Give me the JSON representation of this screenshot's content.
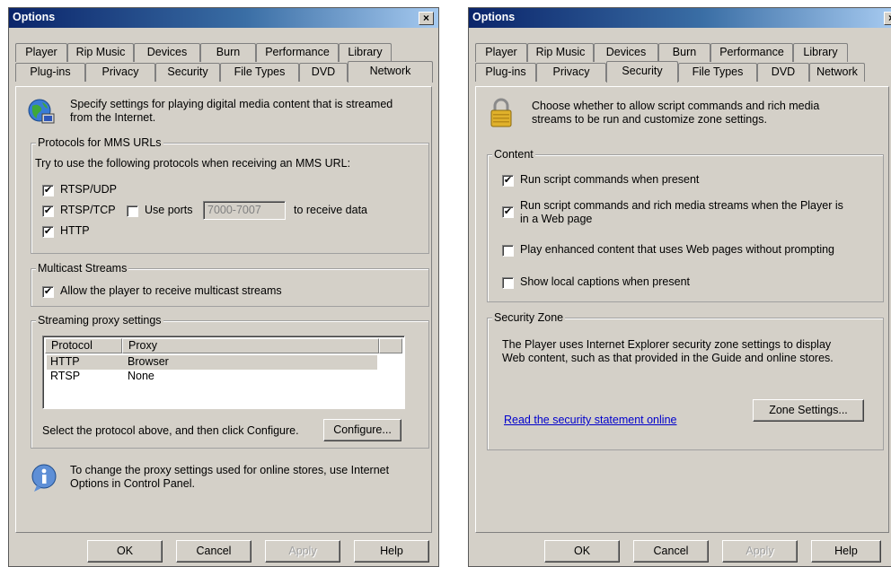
{
  "windowA": {
    "title": "Options",
    "close_glyph": "×",
    "tabs_row1": [
      "Player",
      "Rip Music",
      "Devices",
      "Burn",
      "Performance",
      "Library"
    ],
    "tabs_row2": [
      "Plug-ins",
      "Privacy",
      "Security",
      "File Types",
      "DVD",
      "Network"
    ],
    "active_tab": "Network",
    "intro_line1": "Specify settings for playing digital media content that is streamed",
    "intro_line2": "from the Internet.",
    "mms": {
      "legend": "Protocols for MMS URLs",
      "instruction": "Try to use the following protocols when receiving an MMS URL:",
      "rtsp_udp": "RTSP/UDP",
      "rtsp_tcp": "RTSP/TCP",
      "use_ports": "Use ports",
      "ports_value": "7000-7007",
      "receive_data": "to receive data",
      "http": "HTTP",
      "checked_mark": "✔"
    },
    "multicast": {
      "legend": "Multicast Streams",
      "allow": "Allow the player to receive multicast streams"
    },
    "proxy": {
      "legend": "Streaming proxy settings",
      "col_protocol": "Protocol",
      "col_proxy": "Proxy",
      "rows": [
        {
          "protocol": "HTTP",
          "proxy": "Browser"
        },
        {
          "protocol": "RTSP",
          "proxy": "None"
        }
      ],
      "hint": "Select the protocol above, and then click Configure.",
      "configure_label": "Configure..."
    },
    "store_note_line1": "To change the proxy settings used for online stores, use Internet",
    "store_note_line2": "Options in Control Panel.",
    "buttons": {
      "ok": "OK",
      "cancel": "Cancel",
      "apply": "Apply",
      "help": "Help"
    }
  },
  "windowB": {
    "title": "Options",
    "close_glyph": "×",
    "tabs_row1": [
      "Player",
      "Rip Music",
      "Devices",
      "Burn",
      "Performance",
      "Library"
    ],
    "tabs_row2": [
      "Plug-ins",
      "Privacy",
      "Security",
      "File Types",
      "DVD",
      "Network"
    ],
    "active_tab": "Security",
    "intro_line1": "Choose whether to allow script commands and rich media",
    "intro_line2": "streams to be run and customize zone settings.",
    "content": {
      "legend": "Content",
      "run_script": "Run script commands when present",
      "run_rich_line1": "Run script commands and rich media streams when the Player is",
      "run_rich_line2": "in a Web page",
      "enhanced": "Play enhanced content that uses Web pages without prompting",
      "captions": "Show local captions when present",
      "checked_mark": "✔"
    },
    "zone": {
      "legend": "Security Zone",
      "text_line1": "The Player uses Internet Explorer security zone settings to display",
      "text_line2": "Web content, such as that provided in the Guide and online stores.",
      "link": "Read the security statement online",
      "zone_settings_label": "Zone Settings..."
    },
    "buttons": {
      "ok": "OK",
      "cancel": "Cancel",
      "apply": "Apply",
      "help": "Help"
    }
  },
  "colors": {
    "titlebar_start": "#0a246a",
    "titlebar_end": "#a6caf0",
    "dialog_face": "#d4d0c8",
    "link": "#0000cc",
    "selected_row": "#d4d0c8"
  }
}
